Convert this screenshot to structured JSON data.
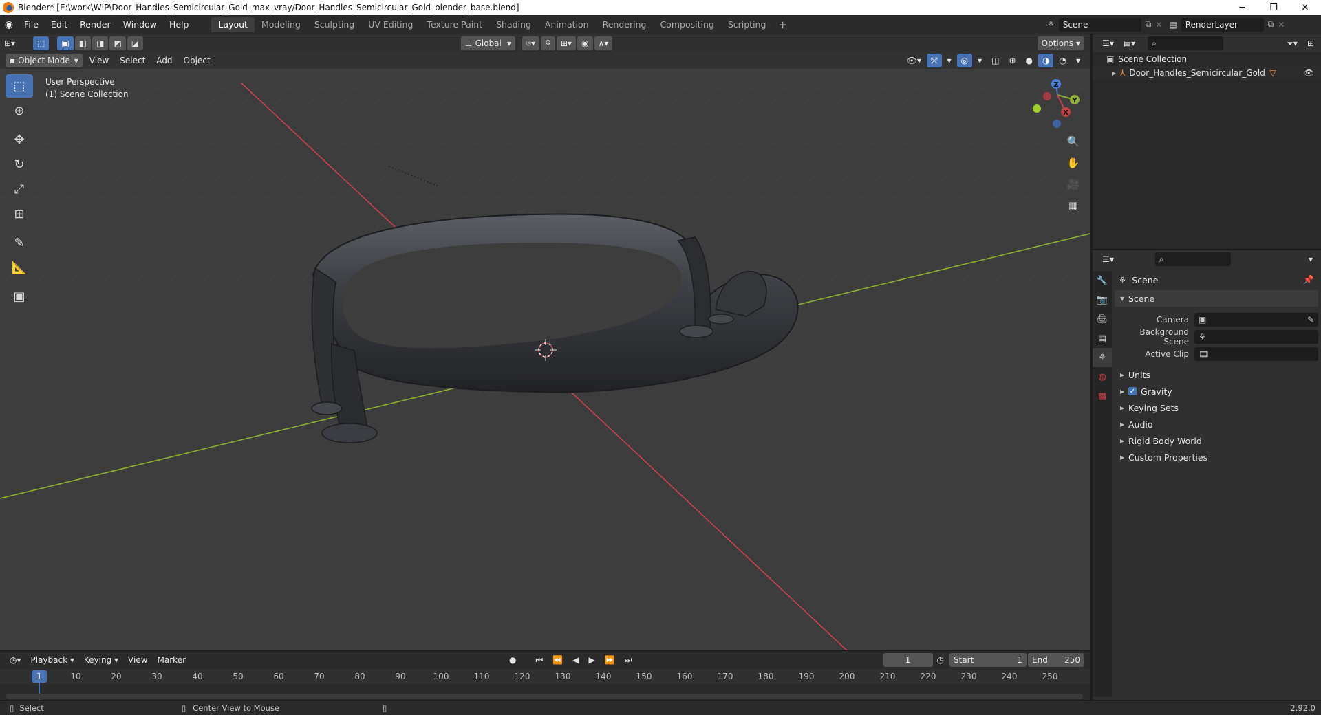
{
  "window": {
    "title": "Blender* [E:\\work\\WIP\\Door_Handles_Semicircular_Gold_max_vray/Door_Handles_Semicircular_Gold_blender_base.blend]",
    "minimize": "─",
    "maximize": "❐",
    "close": "✕"
  },
  "menu": {
    "file": "File",
    "edit": "Edit",
    "render": "Render",
    "window": "Window",
    "help": "Help"
  },
  "workspaces": [
    "Layout",
    "Modeling",
    "Sculpting",
    "UV Editing",
    "Texture Paint",
    "Shading",
    "Animation",
    "Rendering",
    "Compositing",
    "Scripting"
  ],
  "workspace_add": "+",
  "scene_name": "Scene",
  "render_layer": "RenderLayer",
  "viewport": {
    "transform_orientation": "Global",
    "options_label": "Options",
    "mode": "Object Mode",
    "view": "View",
    "select": "Select",
    "add": "Add",
    "object": "Object",
    "perspective_label": "User Perspective",
    "collection_label": "(1) Scene Collection",
    "gizmo_x": "X",
    "gizmo_y": "Y",
    "gizmo_z": "Z"
  },
  "timeline": {
    "playback": "Playback",
    "keying": "Keying",
    "view": "View",
    "marker": "Marker",
    "current_frame": "1",
    "start_label": "Start",
    "start_value": "1",
    "end_label": "End",
    "end_value": "250",
    "ruler": [
      "10",
      "20",
      "30",
      "40",
      "50",
      "60",
      "70",
      "80",
      "90",
      "100",
      "110",
      "120",
      "130",
      "140",
      "150",
      "160",
      "170",
      "180",
      "190",
      "200",
      "210",
      "220",
      "230",
      "240",
      "250"
    ]
  },
  "statusbar": {
    "select": "Select",
    "center_view": "Center View to Mouse",
    "version": "2.92.0"
  },
  "outliner": {
    "scene_collection": "Scene Collection",
    "object_name": "Door_Handles_Semicircular_Gold"
  },
  "properties": {
    "context": "Scene",
    "panel_scene": "Scene",
    "camera_label": "Camera",
    "background_scene_label": "Background Scene",
    "active_clip_label": "Active Clip",
    "panels": [
      "Units",
      "Gravity",
      "Keying Sets",
      "Audio",
      "Rigid Body World",
      "Custom Properties"
    ]
  },
  "colors": {
    "accent": "#4772b3",
    "axis_x": "#c7404a",
    "axis_y": "#8db033",
    "axis_z": "#4b7fd6"
  }
}
